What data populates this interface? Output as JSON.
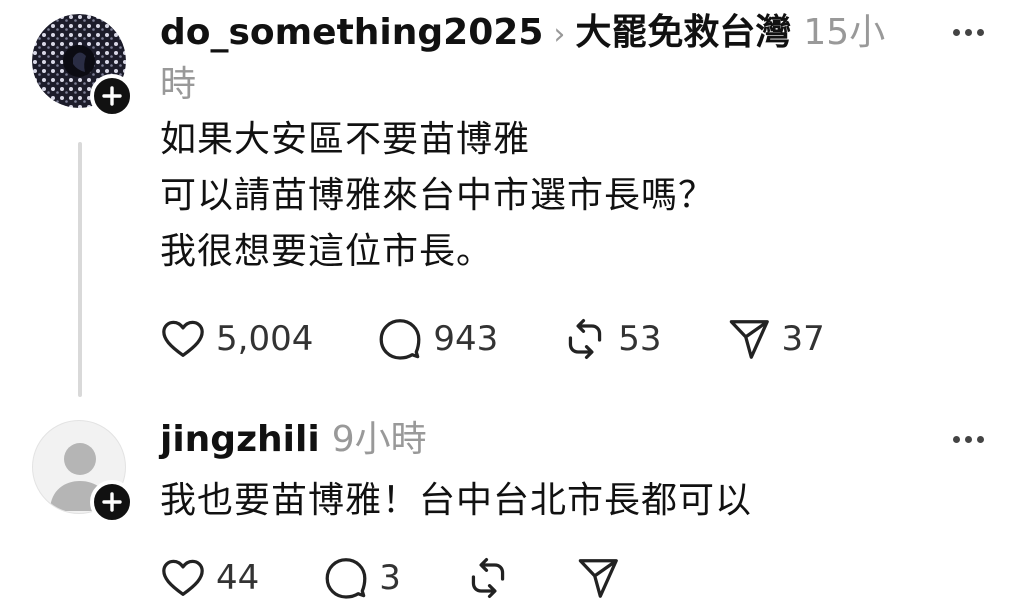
{
  "post1": {
    "username": "do_something2025",
    "chevron": "›",
    "topic": "大罷免救台灣",
    "time_line1": "15小",
    "time_line2": "時",
    "lines": [
      "如果大安區不要苗博雅",
      "可以請苗博雅來台中市選市長嗎？",
      "我很想要這位市長。"
    ],
    "likes": "5,004",
    "comments": "943",
    "reposts": "53",
    "shares": "37",
    "icons": [
      "heart-icon",
      "comment-icon",
      "repost-icon",
      "share-icon",
      "more-icon",
      "plus-icon"
    ]
  },
  "post2": {
    "username": "jingzhili",
    "time": "9小時",
    "text": "我也要苗博雅！台中台北市長都可以",
    "likes": "44",
    "comments": "3",
    "icons": [
      "heart-icon",
      "comment-icon",
      "repost-icon",
      "share-icon",
      "more-icon",
      "plus-icon",
      "default-avatar-icon"
    ]
  },
  "colors": {
    "text": "#111111",
    "muted": "#999999",
    "thread_line": "#d9d9d9",
    "follow_badge": "#111111"
  }
}
